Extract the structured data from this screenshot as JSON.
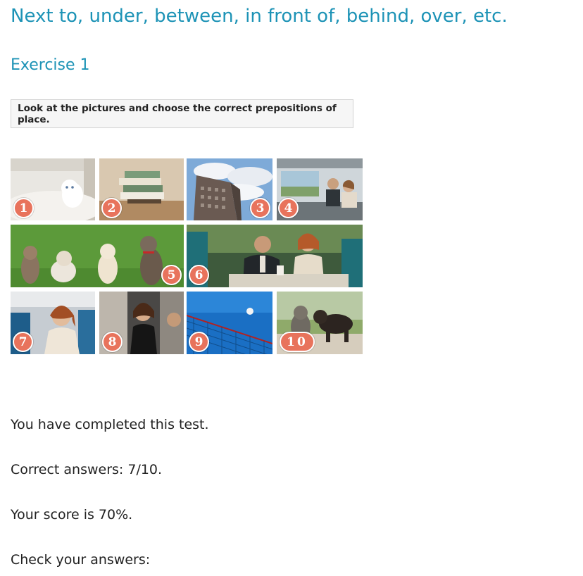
{
  "page": {
    "title": "Next to, under, between, in front of, behind, over, etc."
  },
  "exercise": {
    "title": "Exercise 1",
    "instruction": "Look at the pictures and choose the correct prepositions of place."
  },
  "collage": {
    "badges": [
      "1",
      "2",
      "3",
      "4",
      "5",
      "6",
      "7",
      "8",
      "9",
      "10"
    ],
    "badge_color": "#e8735c"
  },
  "results": {
    "completed": "You have completed this test.",
    "correct": "Correct answers: 7/10.",
    "score": "Your score is 70%.",
    "check": "Check your answers:"
  },
  "colors": {
    "heading": "#1d93b6",
    "instruction_bg": "#f6f6f6",
    "instruction_border": "#d3d3d3"
  }
}
